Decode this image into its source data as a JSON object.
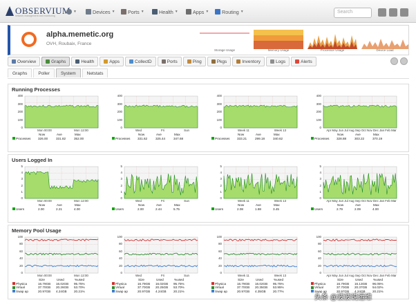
{
  "topnav": {
    "logo": "OBSERVIUM",
    "logo_sub": "network management and monitoring",
    "items": [
      {
        "label": "Devices",
        "icon": "server-icon",
        "color": "#6f7a8a"
      },
      {
        "label": "Ports",
        "icon": "ports-icon",
        "color": "#7a6f6a"
      },
      {
        "label": "Health",
        "icon": "health-icon",
        "color": "#4a5d72"
      },
      {
        "label": "Apps",
        "icon": "apps-icon",
        "color": "#6d6d6d"
      },
      {
        "label": "Routing",
        "icon": "routing-icon",
        "color": "#3a74c6"
      }
    ],
    "search_placeholder": "Search"
  },
  "host": {
    "name": "alpha.memetic.org",
    "location": "OVH, Roubaix, France",
    "mini_graphs": [
      "Storage Usage",
      "Memory Usage",
      "Processor Usage",
      "Device Load"
    ]
  },
  "tabs": [
    {
      "label": "Overview",
      "color": "#5b7aa8"
    },
    {
      "label": "Graphs",
      "color": "#4a8a3c",
      "active": true
    },
    {
      "label": "Health",
      "color": "#4a5d72"
    },
    {
      "label": "Apps",
      "color": "#d39a2c"
    },
    {
      "label": "CollectD",
      "color": "#4f8ccc"
    },
    {
      "label": "Ports",
      "color": "#7a6f6a"
    },
    {
      "label": "Ping",
      "color": "#c08a40"
    },
    {
      "label": "Pkgs",
      "color": "#8e6f3f"
    },
    {
      "label": "Inventory",
      "color": "#b07d3a"
    },
    {
      "label": "Logs",
      "color": "#8f8f8f"
    },
    {
      "label": "Alerts",
      "color": "#d9493c"
    }
  ],
  "subtabs": [
    {
      "label": "Graphs"
    },
    {
      "label": "Poller"
    },
    {
      "label": "System",
      "active": true
    },
    {
      "label": "Netstats"
    }
  ],
  "sections": [
    {
      "title": "Running Processes",
      "graphs": [
        {
          "yticks": [
            "400",
            "300",
            "200",
            "100",
            "0"
          ],
          "xticks": [
            "Mon 00:00",
            "Mon 12:00"
          ],
          "series": [
            {
              "name": "Processes",
              "color": "#17a317"
            }
          ],
          "legend_head": [
            "Now",
            "Ave",
            "Max"
          ],
          "legend_vals": [
            [
              "326.00",
              "331.82",
              "352.00"
            ]
          ]
        },
        {
          "yticks": [
            "400",
            "300",
            "200",
            "100",
            "0"
          ],
          "xticks": [
            "Wed",
            "Fri",
            "Sun"
          ],
          "series": [
            {
              "name": "Processes",
              "color": "#17a317"
            }
          ],
          "legend_head": [
            "Now",
            "Ave",
            "Max"
          ],
          "legend_vals": [
            [
              "331.62",
              "325.44",
              "347.68"
            ]
          ]
        },
        {
          "yticks": [
            "400",
            "300",
            "200",
            "100",
            "0"
          ],
          "xticks": [
            "Week 11",
            "Week 13"
          ],
          "series": [
            {
              "name": "Processes",
              "color": "#17a317"
            }
          ],
          "legend_head": [
            "Now",
            "Ave",
            "Max"
          ],
          "legend_vals": [
            [
              "333.21",
              "299.18",
              "340.62"
            ]
          ]
        },
        {
          "yticks": [
            "400",
            "300",
            "200",
            "100",
            "0"
          ],
          "xticks": [
            "Apr May Jun Jul Aug Sep Oct Nov Dec Jan Feb Mar"
          ],
          "series": [
            {
              "name": "Processes",
              "color": "#17a317"
            }
          ],
          "legend_head": [
            "Now",
            "Ave",
            "Max"
          ],
          "legend_vals": [
            [
              "328.88",
              "303.22",
              "370.19"
            ]
          ]
        }
      ]
    },
    {
      "title": "Users Logged In",
      "graphs": [
        {
          "yticks": [
            "5",
            "4",
            "3",
            "2",
            "1",
            "0"
          ],
          "xticks": [
            "Mon 00:00",
            "Mon 12:00"
          ],
          "series": [
            {
              "name": "Users",
              "color": "#17a317"
            }
          ],
          "legend_head": [
            "Now",
            "Ave",
            "Max"
          ],
          "legend_vals": [
            [
              "2.00",
              "2.21",
              "4.00"
            ]
          ]
        },
        {
          "yticks": [
            "5",
            "4",
            "3",
            "2",
            "1",
            "0"
          ],
          "xticks": [
            "Wed",
            "Fri",
            "Sun"
          ],
          "series": [
            {
              "name": "Users",
              "color": "#17a317"
            }
          ],
          "legend_head": [
            "Now",
            "Ave",
            "Max"
          ],
          "legend_vals": [
            [
              "2.00",
              "2.44",
              "5.75"
            ]
          ]
        },
        {
          "yticks": [
            "5",
            "4",
            "3",
            "2",
            "1",
            "0"
          ],
          "xticks": [
            "Week 11",
            "Week 13"
          ],
          "series": [
            {
              "name": "Users",
              "color": "#17a317"
            }
          ],
          "legend_head": [
            "Now",
            "Ave",
            "Max"
          ],
          "legend_vals": [
            [
              "2.08",
              "1.88",
              "3.45"
            ]
          ]
        },
        {
          "yticks": [
            "5",
            "4",
            "3",
            "2",
            "1",
            "0"
          ],
          "xticks": [
            "Apr May Jun Jul Aug Sep Oct Nov Dec Jan Feb Mar"
          ],
          "series": [
            {
              "name": "Users",
              "color": "#17a317"
            }
          ],
          "legend_head": [
            "Now",
            "Ave",
            "Max"
          ],
          "legend_vals": [
            [
              "2.79",
              "2.09",
              "4.00"
            ]
          ]
        }
      ]
    },
    {
      "title": "Memory Pool Usage",
      "graphs": [
        {
          "yticks": [
            "100",
            "80",
            "60",
            "40",
            "20",
            "0"
          ],
          "xticks": [
            "Mon 00:00",
            "Mon 12:00"
          ],
          "series": [
            {
              "name": "Physica",
              "color": "#d32f2f"
            },
            {
              "name": "Virtual",
              "color": "#2e8b2e"
            },
            {
              "name": "Swap ap",
              "color": "#3f7fd1"
            }
          ],
          "legend_head": [
            "Size",
            "Used",
            "%used"
          ],
          "legend_vals": [
            [
              "16.79GB",
              "16.02GB",
              "95.75%"
            ],
            [
              "37.70GB",
              "20.26GB",
              "53.70%"
            ],
            [
              "20.97GB",
              "4.24GB",
              "20.21%"
            ]
          ]
        },
        {
          "yticks": [
            "100",
            "80",
            "60",
            "40",
            "20",
            "0"
          ],
          "xticks": [
            "Wed",
            "Fri",
            "Sun"
          ],
          "series": [
            {
              "name": "Physica",
              "color": "#d32f2f"
            },
            {
              "name": "Virtual",
              "color": "#2e8b2e"
            },
            {
              "name": "Swap ap",
              "color": "#3f7fd1"
            }
          ],
          "legend_head": [
            "Size",
            "Used",
            "%used"
          ],
          "legend_vals": [
            [
              "16.79GB",
              "16.02GB",
              "95.75%"
            ],
            [
              "37.70GB",
              "20.25GB",
              "53.70%"
            ],
            [
              "20.97GB",
              "4.24GB",
              "20.21%"
            ]
          ]
        },
        {
          "yticks": [
            "100",
            "80",
            "60",
            "40",
            "20",
            "0"
          ],
          "xticks": [
            "Week 11",
            "Week 13"
          ],
          "series": [
            {
              "name": "Physica",
              "color": "#d32f2f"
            },
            {
              "name": "Virtual",
              "color": "#2e8b2e"
            },
            {
              "name": "Swap ap",
              "color": "#3f7fd1"
            }
          ],
          "legend_head": [
            "Size",
            "Used",
            "%used"
          ],
          "legend_vals": [
            [
              "16.79GB",
              "16.02GB",
              "95.75%"
            ],
            [
              "37.70GB",
              "20.35GB",
              "53.95%"
            ],
            [
              "20.97GB",
              "4.35GB",
              "20.77%"
            ]
          ]
        },
        {
          "yticks": [
            "100",
            "80",
            "60",
            "40",
            "20",
            "0"
          ],
          "xticks": [
            "Apr May Jun Jul Aug Sep Oct Nov Dec Jan Feb Mar"
          ],
          "series": [
            {
              "name": "Physica",
              "color": "#d32f2f"
            },
            {
              "name": "Virtual",
              "color": "#2e8b2e"
            },
            {
              "name": "Swap ap",
              "color": "#3f7fd1"
            }
          ],
          "legend_head": [
            "Size",
            "Used",
            "%used"
          ],
          "legend_vals": [
            [
              "16.79GB",
              "16.13GB",
              "96.05%"
            ],
            [
              "37.70GB",
              "20.37GB",
              "54.02%"
            ],
            [
              "20.97GB",
              "4.24GB",
              "20.21%"
            ]
          ]
        }
      ]
    }
  ],
  "watermark": "头条 @波波说运维"
}
